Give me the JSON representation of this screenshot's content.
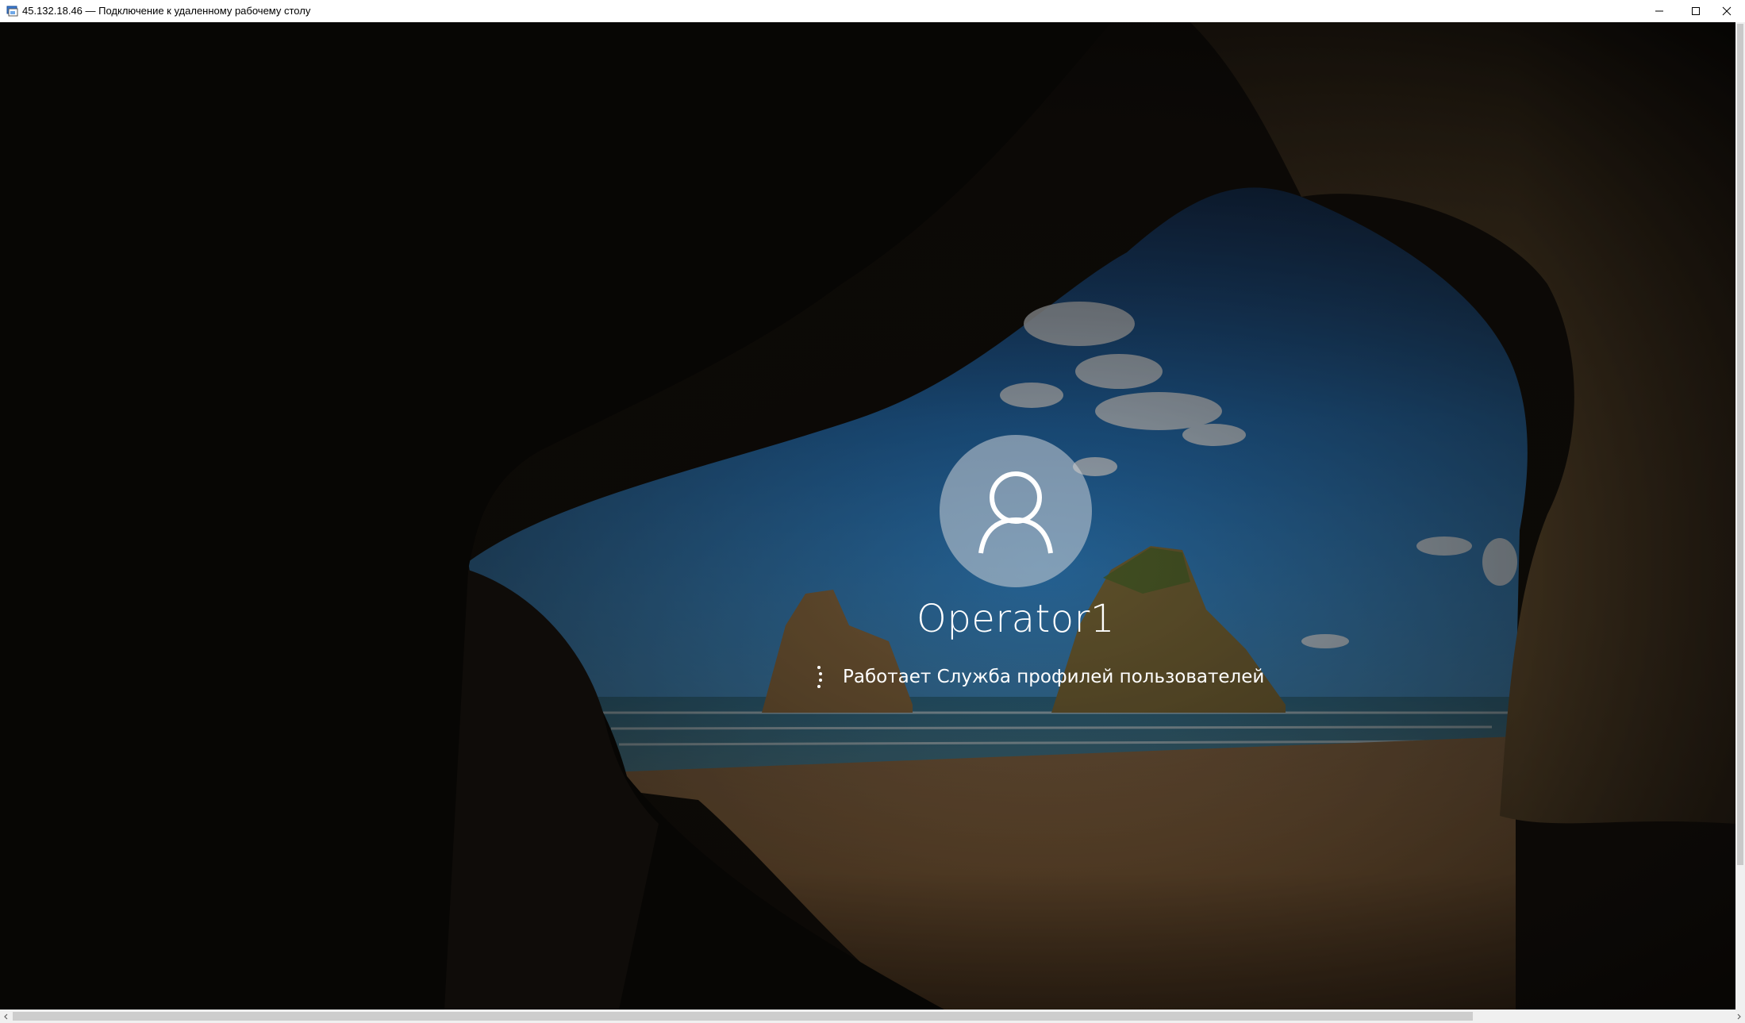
{
  "window": {
    "title": "45.132.18.46 — Подключение к удаленному рабочему столу",
    "icon": "remote-desktop-icon",
    "controls": [
      "minimize-icon",
      "maximize-icon",
      "close-icon"
    ]
  },
  "login": {
    "username": "Operator1",
    "status_message": "Работает Служба профилей пользователей",
    "avatar_icon": "user-avatar-icon",
    "spinner_icon": "loading-spinner-icon"
  },
  "colors": {
    "titlebar_bg": "#ffffff",
    "sky": "#1f6fb8",
    "sand": "#c98d4f",
    "rock": "#3b2c1c"
  }
}
